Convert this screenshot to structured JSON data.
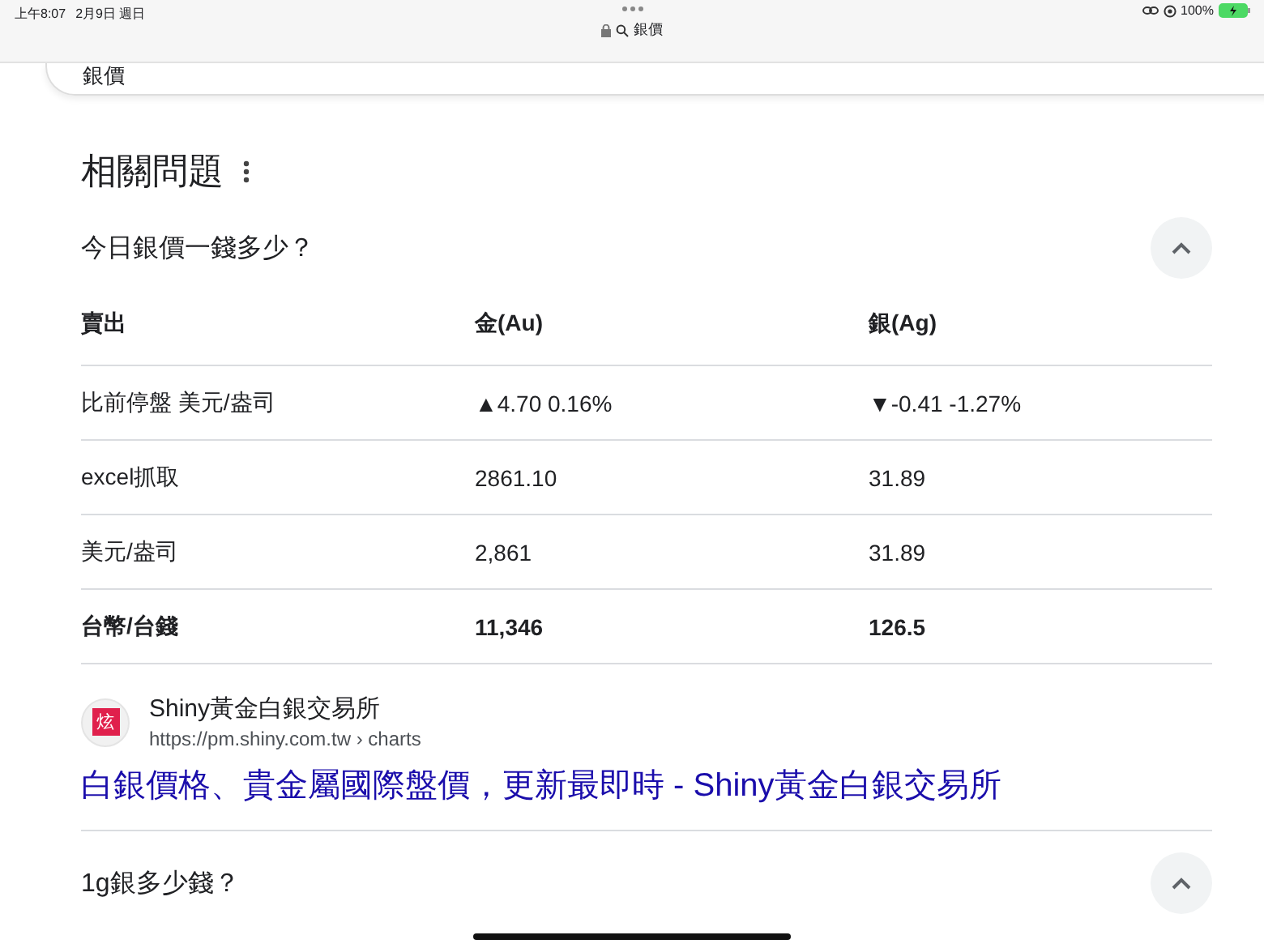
{
  "status_bar": {
    "time": "上午8:07",
    "date": "2月9日 週日",
    "address": "銀價",
    "battery": "100%"
  },
  "search": {
    "value": "銀價"
  },
  "section": {
    "title": "相關問題"
  },
  "questions": [
    {
      "text": "今日銀價一錢多少？",
      "expanded": true,
      "table": {
        "columns": [
          "賣出",
          "金(Au)",
          "銀(Ag)"
        ],
        "rows": [
          {
            "bold": false,
            "cells": [
              "比前停盤 美元/盎司",
              "▲4.70 0.16%",
              "▼-0.41 -1.27%"
            ]
          },
          {
            "bold": false,
            "cells": [
              "excel抓取",
              "2861.10",
              "31.89"
            ]
          },
          {
            "bold": false,
            "cells": [
              "美元/盎司",
              "2,861",
              "31.89"
            ]
          },
          {
            "bold": true,
            "cells": [
              "台幣/台錢",
              "11,346",
              "126.5"
            ]
          }
        ]
      },
      "source": {
        "site": "Shiny黃金白銀交易所",
        "url": "https://pm.shiny.com.tw › charts",
        "favicon": "炫",
        "link": "白銀價格、貴金屬國際盤價，更新最即時 - Shiny黃金白銀交易所"
      }
    },
    {
      "text": "1g銀多少錢？",
      "expanded": true
    }
  ]
}
